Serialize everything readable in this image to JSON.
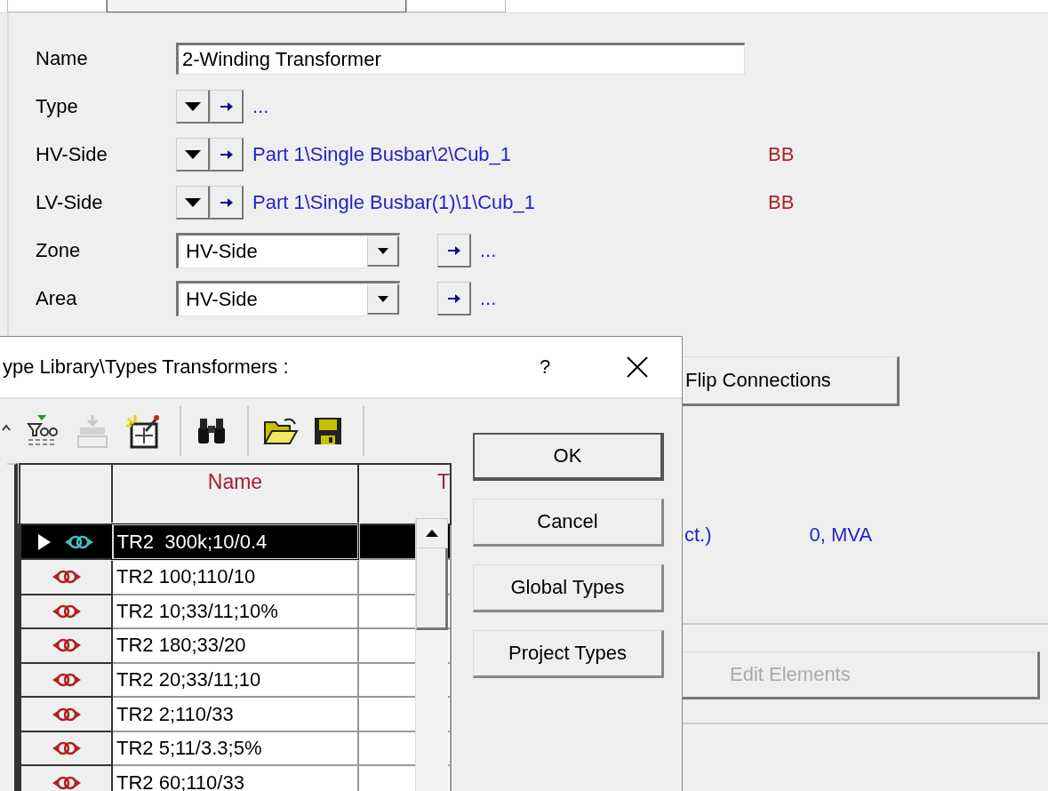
{
  "tab_strip": {
    "tabs": [
      {
        "selected": false
      },
      {
        "selected": true
      },
      {
        "selected": false
      }
    ]
  },
  "fields": [
    {
      "kind": "text",
      "label": "Name",
      "value": "2-Winding Transformer"
    },
    {
      "kind": "link",
      "label": "Type",
      "value": "..."
    },
    {
      "kind": "link",
      "label": "HV-Side",
      "value": "Part 1\\Single Busbar\\2\\Cub_1",
      "tag": "BB"
    },
    {
      "kind": "link",
      "label": "LV-Side",
      "value": "Part 1\\Single Busbar(1)\\1\\Cub_1",
      "tag": "BB"
    },
    {
      "kind": "select",
      "label": "Zone",
      "value": "HV-Side",
      "link": "..."
    },
    {
      "kind": "select",
      "label": "Area",
      "value": "HV-Side",
      "link": "..."
    }
  ],
  "flip_button": {
    "label": "Flip Connections"
  },
  "rating": {
    "label": "ct.)",
    "value": "0, MVA"
  },
  "edit_button": {
    "label": "Edit Elements",
    "disabled": true
  },
  "dialog": {
    "title": "ype Library\\Types Transformers :",
    "help": "?",
    "toolbar": [
      [
        {
          "kind": "caret",
          "disabled": false
        },
        {
          "kind": "filter",
          "disabled": false
        },
        {
          "kind": "paste",
          "disabled": true
        },
        {
          "kind": "new",
          "disabled": false
        }
      ],
      [
        {
          "kind": "find",
          "disabled": false
        }
      ],
      [
        {
          "kind": "open",
          "disabled": false
        },
        {
          "kind": "save",
          "disabled": false
        }
      ]
    ],
    "table": {
      "columns": [
        "Name",
        "T"
      ],
      "rows": [
        {
          "name": "TR2  300k;10/0.4",
          "selected": true
        },
        {
          "name": "TR2 100;110/10",
          "selected": false
        },
        {
          "name": "TR2 10;33/11;10%",
          "selected": false
        },
        {
          "name": "TR2 180;33/20",
          "selected": false
        },
        {
          "name": "TR2 20;33/11;10",
          "selected": false
        },
        {
          "name": "TR2 2;110/33",
          "selected": false
        },
        {
          "name": "TR2 5;11/3.3;5%",
          "selected": false
        },
        {
          "name": "TR2 60;110/33",
          "selected": false
        }
      ]
    },
    "buttons": [
      {
        "label": "OK",
        "default": true
      },
      {
        "label": "Cancel",
        "default": false
      },
      {
        "label": "Global Types",
        "default": false
      },
      {
        "label": "Project Types",
        "default": false
      }
    ]
  }
}
